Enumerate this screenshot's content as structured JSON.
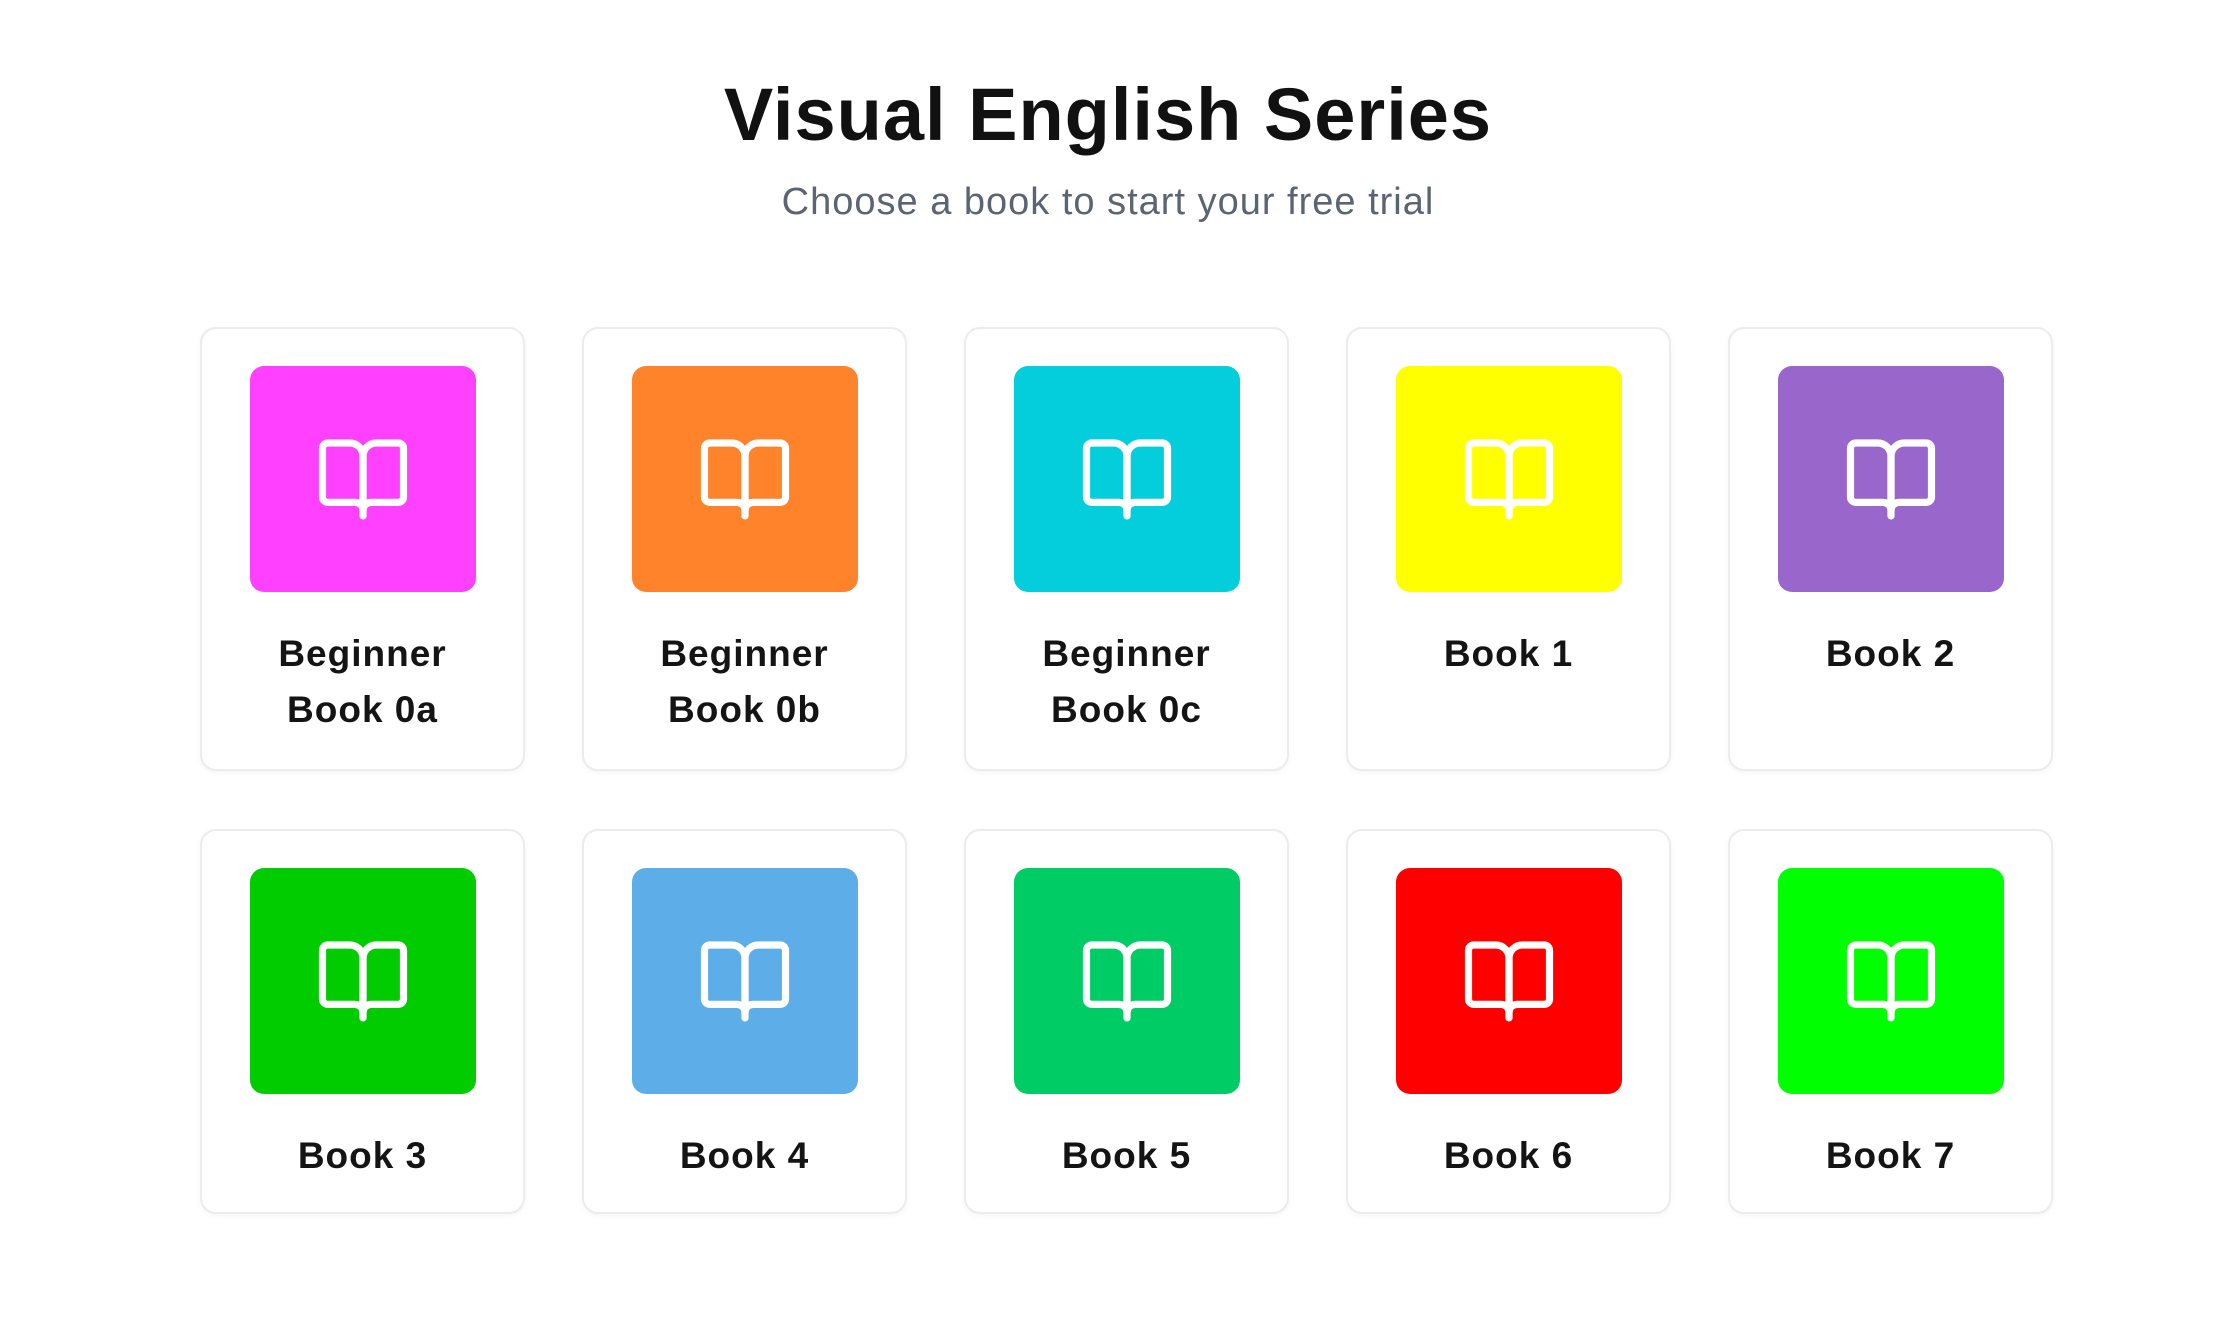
{
  "header": {
    "title": "Visual English Series",
    "subtitle": "Choose a book to start your free trial"
  },
  "books": [
    {
      "label": "Beginner\nBook 0a",
      "color": "#ff40ff",
      "icon": "open-book-icon"
    },
    {
      "label": "Beginner\nBook 0b",
      "color": "#ff832a",
      "icon": "open-book-icon"
    },
    {
      "label": "Beginner\nBook 0c",
      "color": "#05cedc",
      "icon": "open-book-icon"
    },
    {
      "label": "Book 1",
      "color": "#ffff00",
      "icon": "open-book-icon"
    },
    {
      "label": "Book 2",
      "color": "#9966cc",
      "icon": "open-book-icon"
    },
    {
      "label": "Book 3",
      "color": "#00cc00",
      "icon": "open-book-icon"
    },
    {
      "label": "Book 4",
      "color": "#5dade9",
      "icon": "open-book-icon"
    },
    {
      "label": "Book 5",
      "color": "#00cc66",
      "icon": "open-book-icon"
    },
    {
      "label": "Book 6",
      "color": "#ff0000",
      "icon": "open-book-icon"
    },
    {
      "label": "Book 7",
      "color": "#00ff00",
      "icon": "open-book-icon"
    }
  ]
}
